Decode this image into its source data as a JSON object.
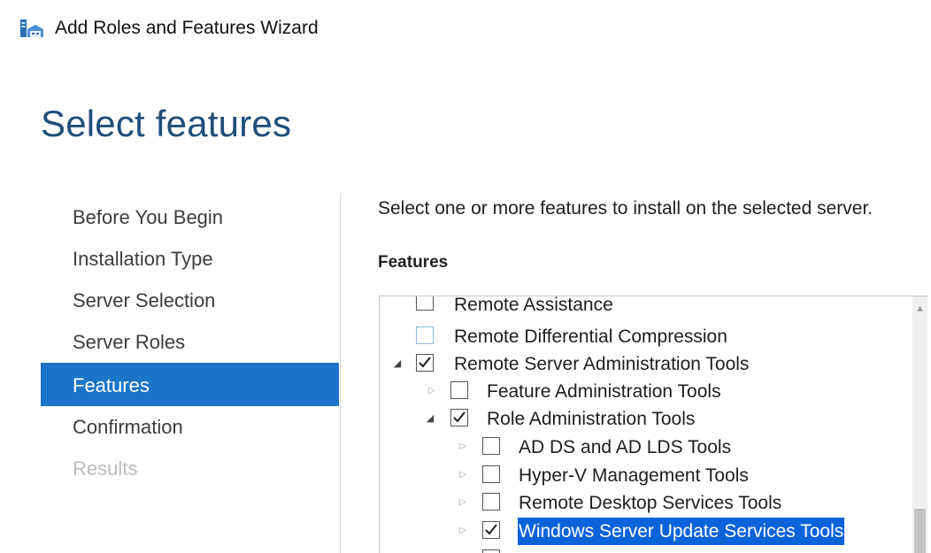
{
  "window": {
    "title": "Add Roles and Features Wizard",
    "icon": "server-manager-wizard-icon"
  },
  "page": {
    "title": "Select features"
  },
  "nav": {
    "items": [
      {
        "label": "Before You Begin",
        "state": "normal"
      },
      {
        "label": "Installation Type",
        "state": "normal"
      },
      {
        "label": "Server Selection",
        "state": "normal"
      },
      {
        "label": "Server Roles",
        "state": "normal"
      },
      {
        "label": "Features",
        "state": "selected"
      },
      {
        "label": "Confirmation",
        "state": "normal"
      },
      {
        "label": "Results",
        "state": "disabled"
      }
    ]
  },
  "content": {
    "instruction": "Select one or more features to install on the selected server.",
    "features_label": "Features"
  },
  "tree": {
    "items": [
      {
        "label": "Remote Assistance",
        "checked": false,
        "expander": "none",
        "level": 0
      },
      {
        "label": "Remote Differential Compression",
        "checked": false,
        "expander": "none",
        "level": 0,
        "focused": true
      },
      {
        "label": "Remote Server Administration Tools",
        "checked": true,
        "expander": "expanded",
        "level": 0
      },
      {
        "label": "Feature Administration Tools",
        "checked": false,
        "expander": "collapsed",
        "level": 1
      },
      {
        "label": "Role Administration Tools",
        "checked": true,
        "expander": "expanded",
        "level": 1
      },
      {
        "label": "AD DS and AD LDS Tools",
        "checked": false,
        "expander": "collapsed",
        "level": 2
      },
      {
        "label": "Hyper-V Management Tools",
        "checked": false,
        "expander": "collapsed",
        "level": 2
      },
      {
        "label": "Remote Desktop Services Tools",
        "checked": false,
        "expander": "collapsed",
        "level": 2
      },
      {
        "label": "Windows Server Update Services Tools",
        "checked": true,
        "expander": "collapsed",
        "level": 2,
        "selected": true
      }
    ]
  },
  "colors": {
    "accent": "#1b74c8",
    "title": "#1f4e79",
    "selection": "#0a63d9"
  }
}
